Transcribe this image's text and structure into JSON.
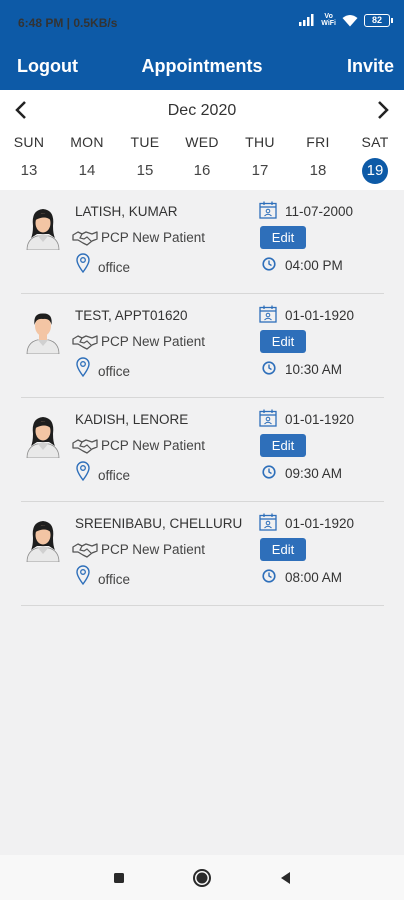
{
  "status_bar": {
    "time_speed": "6:48 PM | 0.5KB/s",
    "volte_top": "Vo",
    "volte_bottom": "WiFi",
    "battery": "82"
  },
  "header": {
    "logout_label": "Logout",
    "title": "Appointments",
    "invite_label": "Invite",
    "color": "#0d5aa7"
  },
  "calendar": {
    "month_label": "Dec 2020",
    "days": [
      {
        "dow": "SUN",
        "num": "13"
      },
      {
        "dow": "MON",
        "num": "14"
      },
      {
        "dow": "TUE",
        "num": "15"
      },
      {
        "dow": "WED",
        "num": "16"
      },
      {
        "dow": "THU",
        "num": "17"
      },
      {
        "dow": "FRI",
        "num": "18"
      },
      {
        "dow": "SAT",
        "num": "19"
      }
    ],
    "selected_day": "19"
  },
  "appointments": [
    {
      "name": "LATISH, KUMAR",
      "type": "PCP New Patient",
      "location": "office",
      "date": "11-07-2000",
      "edit_label": "Edit",
      "time": "04:00 PM",
      "avatar": "female-avatar"
    },
    {
      "name": "TEST, APPT01620",
      "type": "PCP New Patient",
      "location": "office",
      "date": "01-01-1920",
      "edit_label": "Edit",
      "time": "10:30 AM",
      "avatar": "male-avatar"
    },
    {
      "name": "KADISH, LENORE",
      "type": "PCP New Patient",
      "location": "office",
      "date": "01-01-1920",
      "edit_label": "Edit",
      "time": "09:30 AM",
      "avatar": "female-avatar"
    },
    {
      "name": "SREENIBABU, CHELLURU",
      "type": "PCP New Patient",
      "location": "office",
      "date": "01-01-1920",
      "edit_label": "Edit",
      "time": "08:00 AM",
      "avatar": "female-avatar"
    }
  ],
  "icons": {
    "type": "handshake-icon",
    "location": "location-pin-icon",
    "date": "calendar-icon",
    "time": "clock-icon"
  }
}
